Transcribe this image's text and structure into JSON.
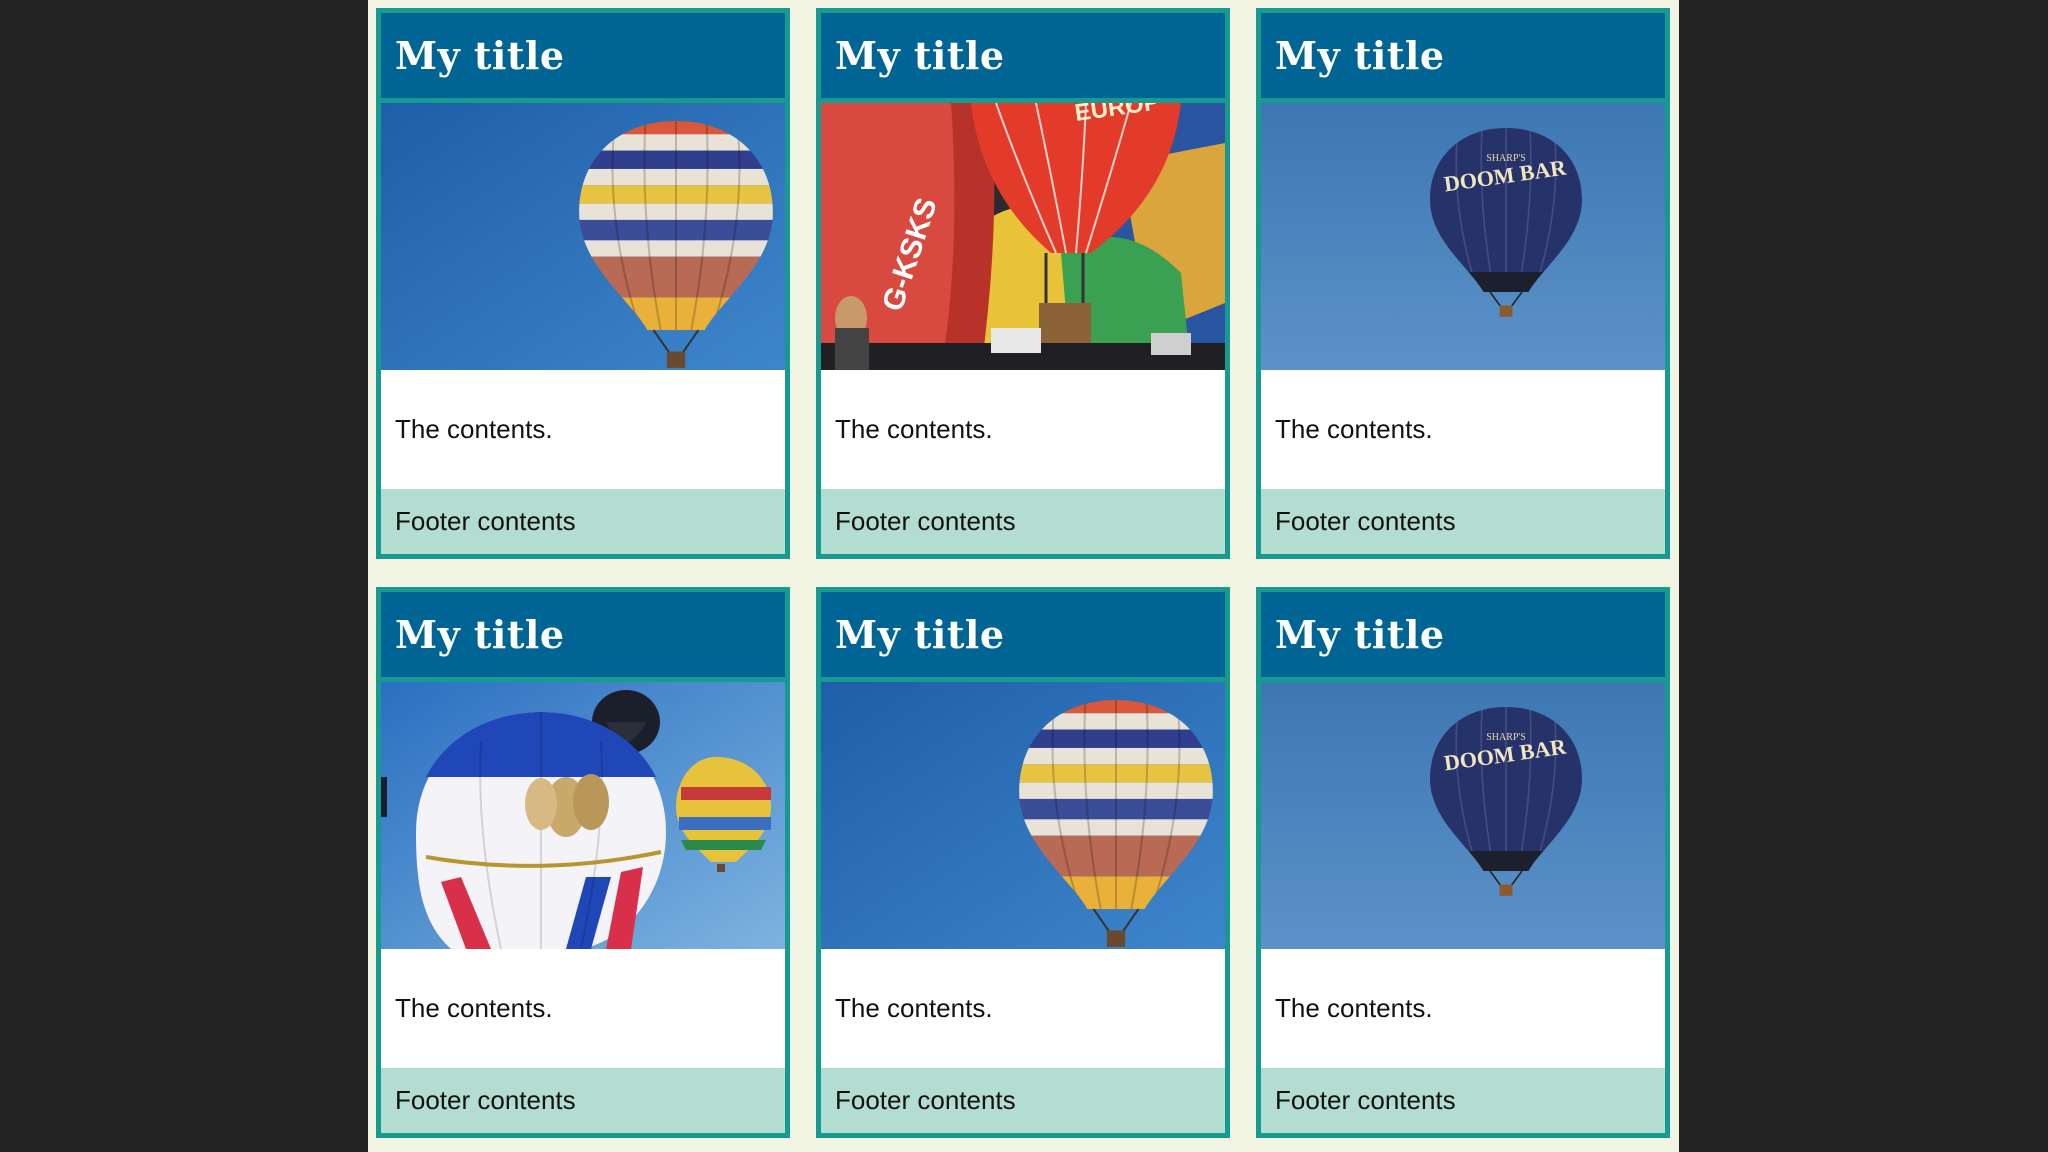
{
  "colors": {
    "header_bg": "#006594",
    "card_border": "#169a92",
    "footer_bg": "#b4ddd2",
    "page_bg": "#f2f5e4",
    "outer_bg": "#232323"
  },
  "cards": [
    {
      "title": "My title",
      "image": "striped-balloon-photo",
      "body": "The contents.",
      "footer": "Footer contents"
    },
    {
      "title": "My title",
      "image": "balloon-festival-photo",
      "body": "The contents.",
      "footer": "Footer contents"
    },
    {
      "title": "My title",
      "image": "doom-bar-balloon-photo",
      "body": "The contents.",
      "footer": "Footer contents"
    },
    {
      "title": "My title",
      "image": "multiple-balloons-photo",
      "body": "The contents.",
      "footer": "Footer contents"
    },
    {
      "title": "My title",
      "image": "striped-balloon-photo",
      "body": "The contents.",
      "footer": "Footer contents"
    },
    {
      "title": "My title",
      "image": "doom-bar-balloon-photo",
      "body": "The contents.",
      "footer": "Footer contents"
    }
  ],
  "balloon_text": {
    "doom_bar": "DOOM BAR",
    "sharps": "SHARP'S",
    "registration": "G-KSKS",
    "europe": "EUROP"
  }
}
